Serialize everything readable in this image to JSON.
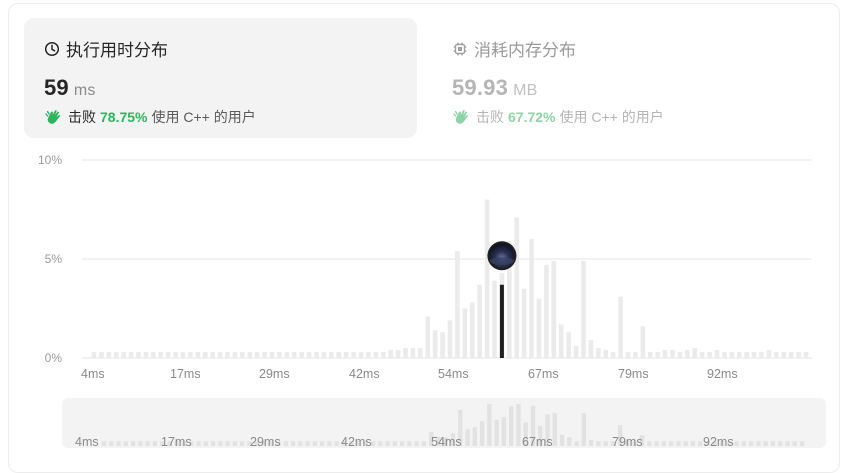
{
  "runtime": {
    "title": "执行用时分布",
    "value": "59",
    "unit": "ms",
    "beat_prefix": "击败",
    "beat_pct": "78.75%",
    "beat_suffix": "使用 C++ 的用户"
  },
  "memory": {
    "title": "消耗内存分布",
    "value": "59.93",
    "unit": "MB",
    "beat_prefix": "击败",
    "beat_pct": "67.72%",
    "beat_suffix": "使用 C++ 的用户"
  },
  "colors": {
    "bar": "#ebebeb",
    "highlight_bar": "#1f1f1f",
    "grid": "#e6e6e6",
    "accent_green": "#2db55d"
  },
  "chart_data": {
    "type": "bar",
    "ylim": [
      0,
      10
    ],
    "yticks": [
      "10%",
      "5%",
      "0%"
    ],
    "ytick_values": [
      10,
      5,
      0
    ],
    "xticks": [
      "4ms",
      "17ms",
      "29ms",
      "42ms",
      "54ms",
      "67ms",
      "79ms",
      "92ms"
    ],
    "x": [
      4,
      5,
      6,
      7,
      8,
      9,
      10,
      11,
      12,
      13,
      14,
      15,
      16,
      17,
      18,
      19,
      20,
      21,
      22,
      23,
      24,
      25,
      26,
      27,
      28,
      29,
      30,
      31,
      32,
      33,
      34,
      35,
      36,
      37,
      38,
      39,
      40,
      41,
      42,
      43,
      44,
      45,
      46,
      47,
      48,
      49,
      50,
      51,
      52,
      53,
      54,
      55,
      56,
      57,
      58,
      59,
      60,
      61,
      62,
      63,
      64,
      65,
      66,
      67,
      68,
      69,
      70,
      71,
      72,
      73,
      74,
      75,
      76,
      77,
      78,
      79,
      80,
      81,
      82,
      83,
      84,
      85,
      86,
      87,
      88,
      89,
      90,
      91,
      92,
      93,
      94,
      95,
      96,
      97,
      98,
      99,
      100
    ],
    "values": [
      0.3,
      0.3,
      0.3,
      0.3,
      0.3,
      0.3,
      0.3,
      0.3,
      0.3,
      0.3,
      0.3,
      0.3,
      0.3,
      0.3,
      0.3,
      0.3,
      0.3,
      0.3,
      0.3,
      0.3,
      0.3,
      0.3,
      0.3,
      0.3,
      0.3,
      0.3,
      0.3,
      0.3,
      0.3,
      0.3,
      0.3,
      0.3,
      0.3,
      0.3,
      0.3,
      0.3,
      0.3,
      0.3,
      0.3,
      0.3,
      0.4,
      0.4,
      0.5,
      0.5,
      0.5,
      2.1,
      1.4,
      1.3,
      1.9,
      5.4,
      2.5,
      2.8,
      3.7,
      8.0,
      3.9,
      4.3,
      5.9,
      7.1,
      3.5,
      6.0,
      3.0,
      4.7,
      4.9,
      1.7,
      1.3,
      0.6,
      4.9,
      0.9,
      0.5,
      0.4,
      0.3,
      3.1,
      0.3,
      0.3,
      1.6,
      0.3,
      0.3,
      0.4,
      0.4,
      0.3,
      0.4,
      0.5,
      0.3,
      0.3,
      0.4,
      0.3,
      0.3,
      0.3,
      0.3,
      0.3,
      0.3,
      0.4,
      0.3,
      0.3,
      0.3,
      0.3,
      0.3
    ],
    "highlight_x": 59,
    "highlight_value": 3.7
  }
}
